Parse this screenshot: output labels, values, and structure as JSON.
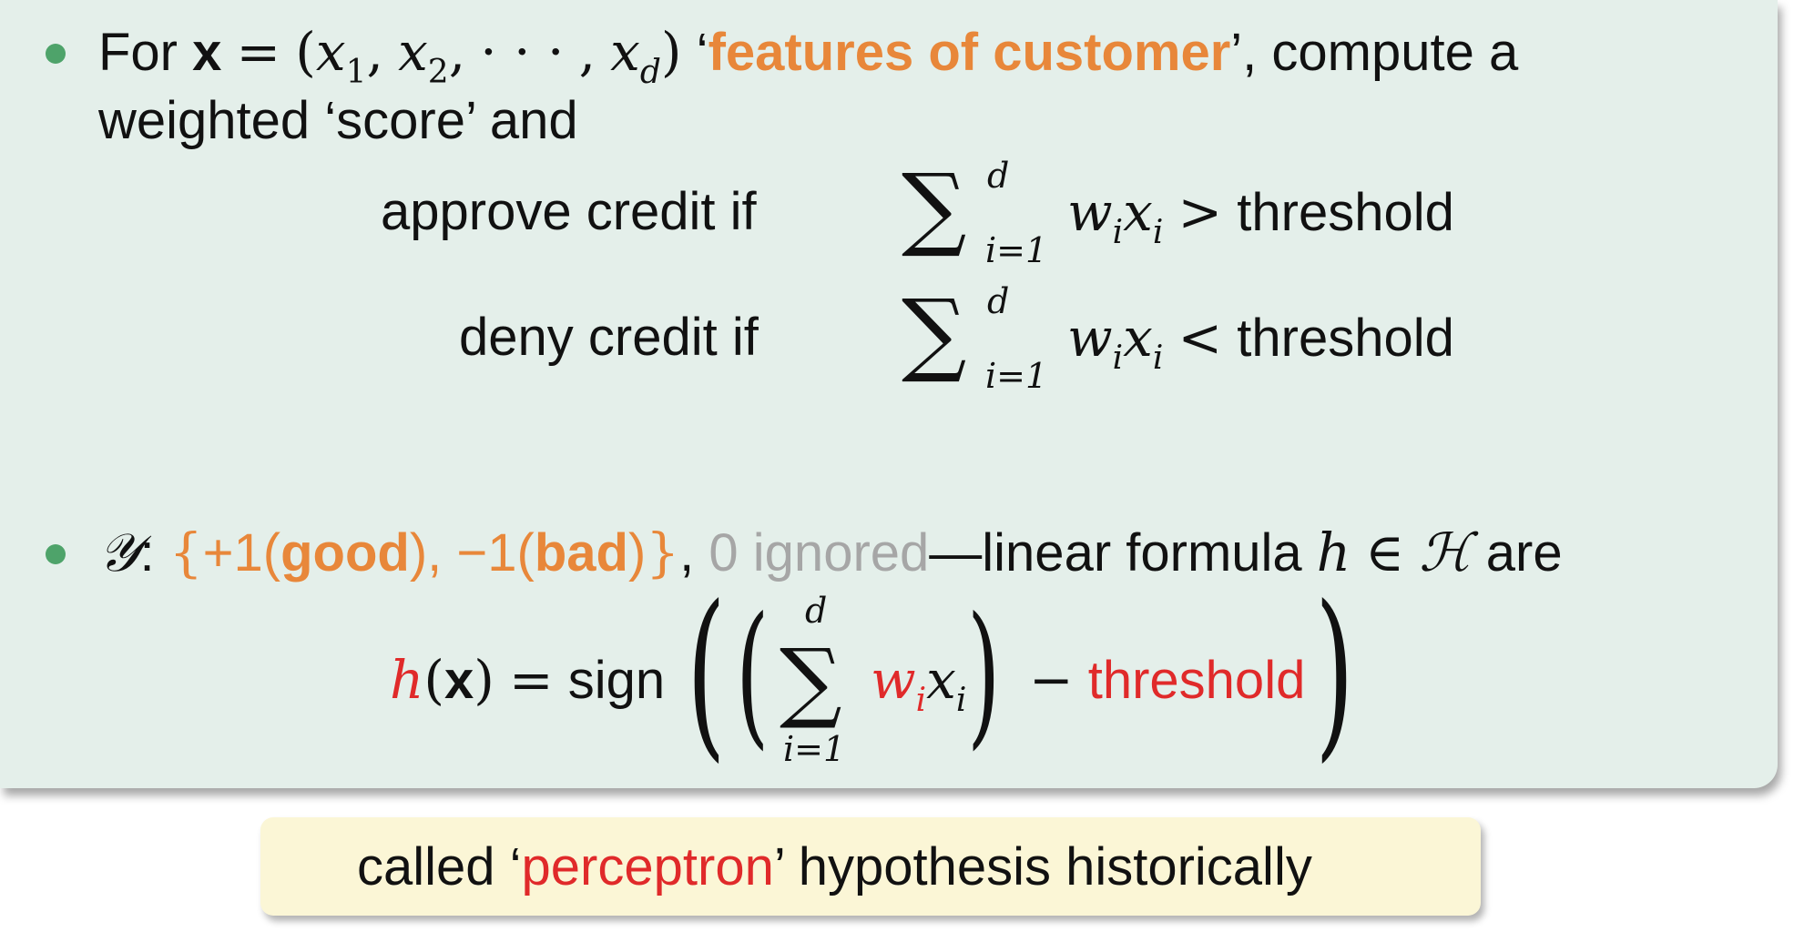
{
  "bullet1": {
    "for_word": "For",
    "x_bold": "x",
    "eq": "=",
    "vector": {
      "open": "(",
      "x1": "x",
      "s1": "1",
      "comma1": ",",
      "x2": "x",
      "s2": "2",
      "comma2": ",",
      "dots": "· · ·",
      "comma3": ",",
      "xd": "x",
      "sd": "d",
      "close": ")"
    },
    "quote_open": "‘",
    "highlight": "features of customer",
    "after_highlight": "’, compute a",
    "line2": "weighted ‘score’ and"
  },
  "rules": [
    {
      "label": "approve credit if",
      "sum_sym": "∑",
      "upper": "d",
      "lower": "i=1",
      "w": "w",
      "wi": "i",
      "x": "x",
      "xi": "i",
      "op": ">",
      "threshold": "threshold"
    },
    {
      "label": "deny credit if",
      "sum_sym": "∑",
      "upper": "d",
      "lower": "i=1",
      "w": "w",
      "wi": "i",
      "x": "x",
      "xi": "i",
      "op": "<",
      "threshold": "threshold"
    }
  ],
  "bullet2": {
    "Y": "𝒴",
    "colon": ":",
    "set_open": "{",
    "plus1": "+1(",
    "good": "good",
    "mid": "), −1(",
    "bad": "bad",
    "close_paren": ")",
    "set_close": "}",
    "comma": ",",
    "ignored": "0 ignored",
    "rest": "—linear formula",
    "h": "h",
    "in": "∈",
    "H": "ℋ",
    "are": "are"
  },
  "formula": {
    "h": "h",
    "open": "(",
    "x": "x",
    "close": ")",
    "eq": "=",
    "sign": "sign",
    "sum_sym": "∑",
    "upper": "d",
    "lower": "i=1",
    "w": "w",
    "wi": "i",
    "x2": "x",
    "xi": "i",
    "minus": "−",
    "threshold": "threshold"
  },
  "callout": {
    "before": "called ‘",
    "highlight": "perceptron",
    "after": "’ hypothesis historically"
  },
  "colors": {
    "panel": "#e4efea",
    "bullet": "#4ea36a",
    "orange": "#e8873a",
    "red": "#e02a2a",
    "gray": "#a6a6a6",
    "callout": "#fbf6d6"
  }
}
